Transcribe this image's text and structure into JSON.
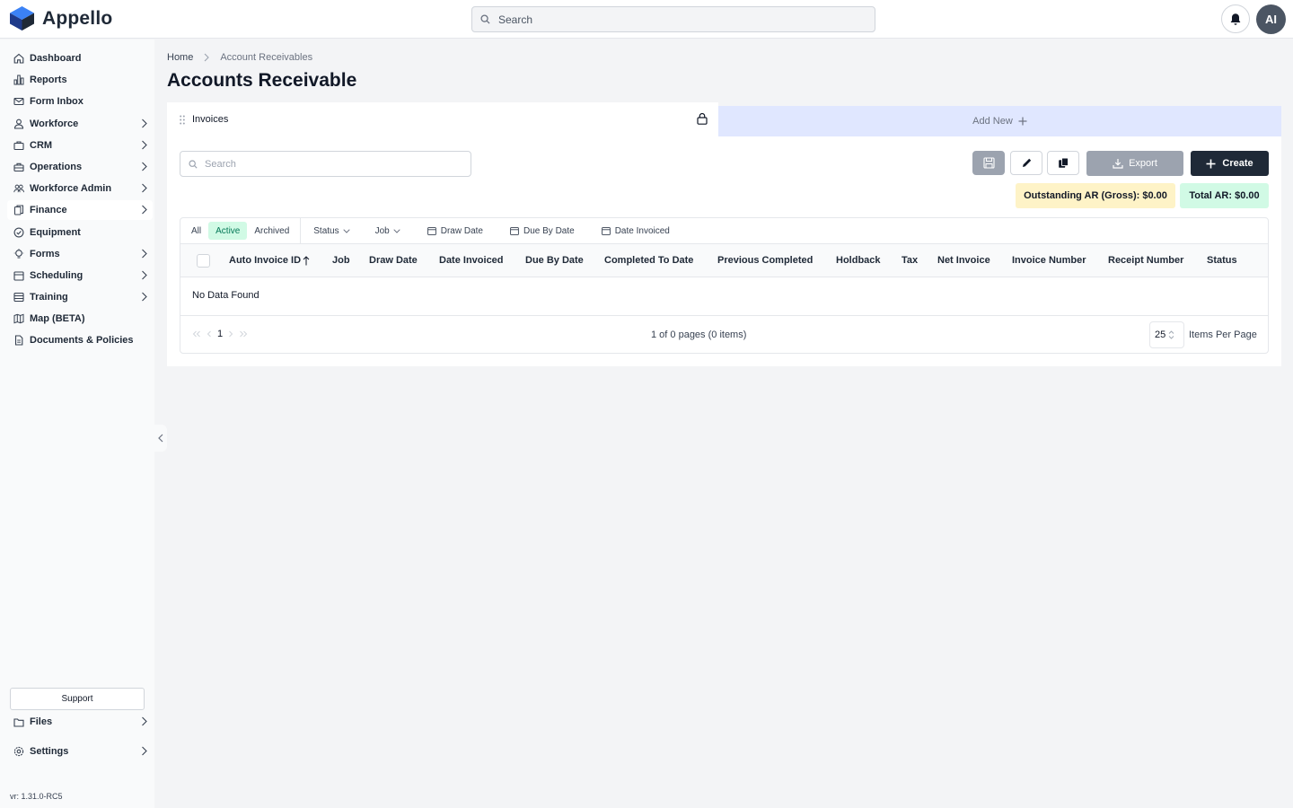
{
  "app": {
    "name": "Appello"
  },
  "topbar": {
    "search_placeholder": "Search",
    "avatar_initials": "AI"
  },
  "sidebar": {
    "items": [
      {
        "label": "Dashboard",
        "icon": "home-icon",
        "chevron": false
      },
      {
        "label": "Reports",
        "icon": "bar-chart-icon",
        "chevron": false
      },
      {
        "label": "Form Inbox",
        "icon": "mail-icon",
        "chevron": false
      },
      {
        "label": "Workforce",
        "icon": "user-icon",
        "chevron": true
      },
      {
        "label": "CRM",
        "icon": "briefcase-icon",
        "chevron": true
      },
      {
        "label": "Operations",
        "icon": "toolbox-icon",
        "chevron": true
      },
      {
        "label": "Workforce Admin",
        "icon": "users-icon",
        "chevron": true
      },
      {
        "label": "Finance",
        "icon": "documents-icon",
        "chevron": true,
        "active": true
      },
      {
        "label": "Equipment",
        "icon": "check-circle-icon",
        "chevron": false
      },
      {
        "label": "Forms",
        "icon": "bulb-icon",
        "chevron": true
      },
      {
        "label": "Scheduling",
        "icon": "calendar-icon",
        "chevron": true
      },
      {
        "label": "Training",
        "icon": "training-icon",
        "chevron": true
      },
      {
        "label": "Map (BETA)",
        "icon": "map-icon",
        "chevron": false
      },
      {
        "label": "Documents & Policies",
        "icon": "file-icon",
        "chevron": false
      }
    ],
    "support_label": "Support",
    "files_label": "Files",
    "settings_label": "Settings",
    "version": "vr: 1.31.0-RC5"
  },
  "breadcrumb": {
    "home": "Home",
    "current": "Account Receivables"
  },
  "page": {
    "title": "Accounts Receivable"
  },
  "tabs": {
    "invoices": "Invoices",
    "add_new": "Add New"
  },
  "toolbar": {
    "search_placeholder": "Search",
    "export_label": "Export",
    "create_label": "Create",
    "outstanding_ar": "Outstanding AR (Gross): $0.00",
    "total_ar": "Total AR: $0.00"
  },
  "filters": {
    "all": "All",
    "active": "Active",
    "archived": "Archived",
    "status": "Status",
    "job": "Job",
    "draw_date": "Draw Date",
    "due_by_date": "Due By Date",
    "date_invoiced": "Date Invoiced"
  },
  "table": {
    "columns": [
      "Auto Invoice ID",
      "Job",
      "Draw Date",
      "Date Invoiced",
      "Due By Date",
      "Completed To Date",
      "Previous Completed",
      "Holdback",
      "Tax",
      "Net Invoice",
      "Invoice Number",
      "Receipt Number",
      "Status"
    ],
    "empty_text": "No Data Found"
  },
  "pagination": {
    "current_page": "1",
    "info": "1 of 0 pages (0 items)",
    "page_size": "25",
    "page_size_label": "Items Per Page"
  },
  "colors": {
    "brand": "#2563eb",
    "primary_dark": "#1f2937",
    "active_filter_bg": "#d1fae5",
    "outstanding_bg": "#fef3c7",
    "add_tab_bg": "#e0e7ff"
  }
}
